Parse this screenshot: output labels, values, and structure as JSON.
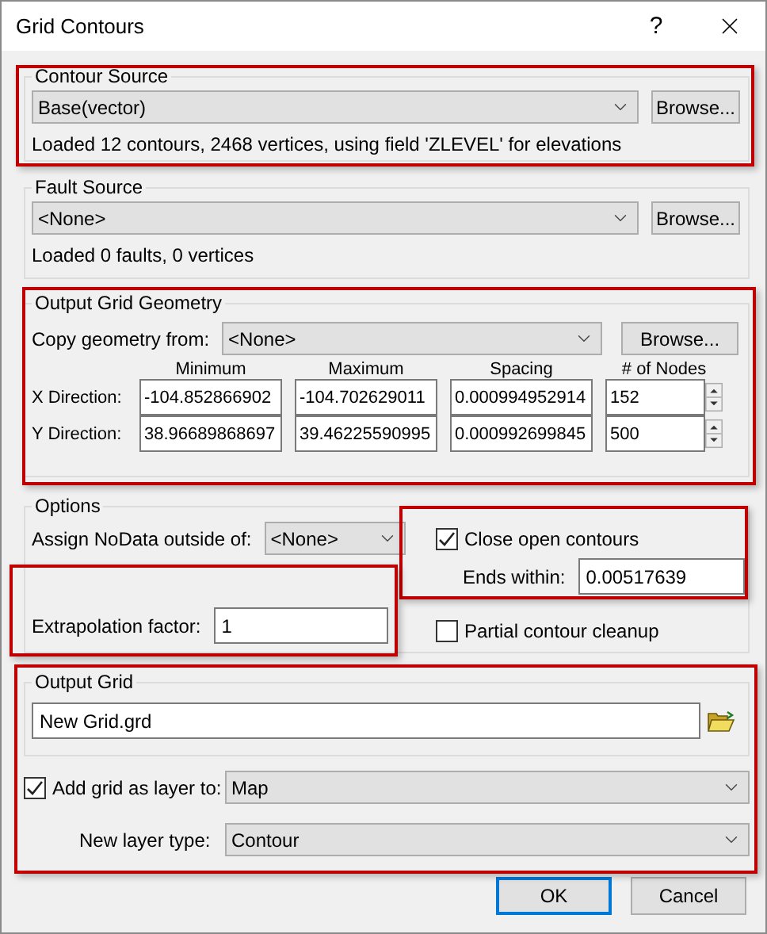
{
  "window": {
    "title": "Grid Contours",
    "help": "?"
  },
  "contour_source": {
    "title": "Contour Source",
    "value": "Base(vector)",
    "browse": "Browse...",
    "info": "Loaded 12 contours, 2468 vertices, using field 'ZLEVEL' for elevations"
  },
  "fault_source": {
    "title": "Fault Source",
    "value": "<None>",
    "browse": "Browse...",
    "info": "Loaded 0 faults, 0 vertices"
  },
  "output_grid_geometry": {
    "title": "Output Grid Geometry",
    "copy_label": "Copy geometry from:",
    "copy_value": "<None>",
    "browse": "Browse...",
    "columns": [
      "Minimum",
      "Maximum",
      "Spacing",
      "# of Nodes"
    ],
    "rows": [
      {
        "label": "X Direction:",
        "minimum": "-104.852866902",
        "maximum": "-104.702629011",
        "spacing": "0.000994952914",
        "nodes": "152"
      },
      {
        "label": "Y Direction:",
        "minimum": "38.96689868697",
        "maximum": "39.46225590995",
        "spacing": "0.000992699845",
        "nodes": "500"
      }
    ]
  },
  "options": {
    "title": "Options",
    "nodata_label": "Assign NoData outside of:",
    "nodata_value": "<None>",
    "close_open": {
      "label": "Close open contours",
      "checked": true
    },
    "ends_within_label": "Ends within:",
    "ends_within": "0.00517639",
    "extrapolation_label": "Extrapolation factor:",
    "extrapolation": "1",
    "partial_cleanup": {
      "label": "Partial contour cleanup",
      "checked": false
    }
  },
  "output_grid": {
    "title": "Output Grid",
    "file": "New Grid.grd",
    "add_layer": {
      "label": "Add grid as layer to:",
      "checked": true
    },
    "layer_target": "Map",
    "layer_type_label": "New layer type:",
    "layer_type": "Contour"
  },
  "buttons": [
    {
      "label": "OK",
      "default": true
    },
    {
      "label": "Cancel",
      "default": false
    }
  ]
}
